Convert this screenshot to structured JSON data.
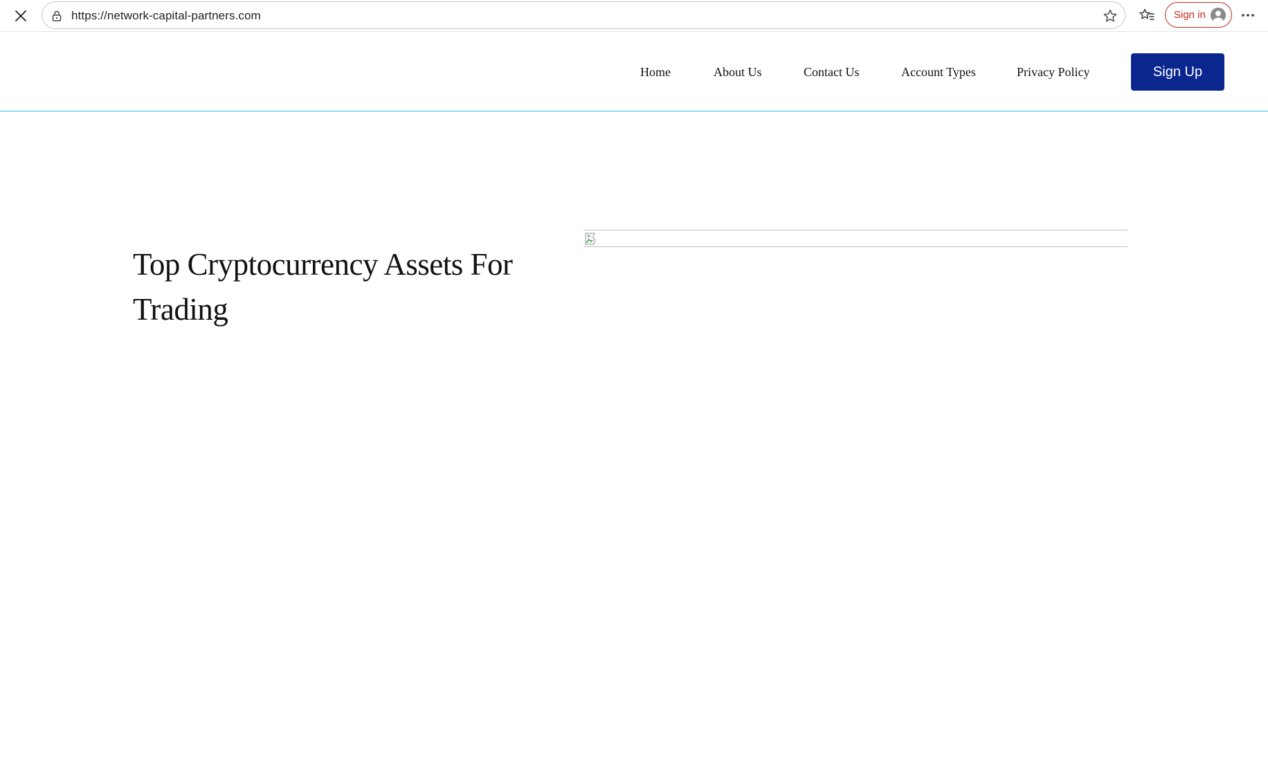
{
  "browser": {
    "url": "https://network-capital-partners.com",
    "signin_label": "Sign in",
    "icons": {
      "close": "close-icon",
      "lock": "lock-icon",
      "star": "star-icon",
      "favorites": "favorites-icon",
      "avatar": "avatar-icon",
      "more": "more-icon"
    },
    "accent_color": "#c42b1c"
  },
  "header": {
    "nav": [
      {
        "label": "Home"
      },
      {
        "label": "About Us"
      },
      {
        "label": "Contact Us"
      },
      {
        "label": "Account Types"
      },
      {
        "label": "Privacy Policy"
      }
    ],
    "signup_label": "Sign Up",
    "signup_color": "#0c2690",
    "divider_color": "#27b8d6"
  },
  "hero": {
    "title": "Top Cryptocurrency Assets For Trading",
    "image_icon": "broken-image-icon"
  }
}
